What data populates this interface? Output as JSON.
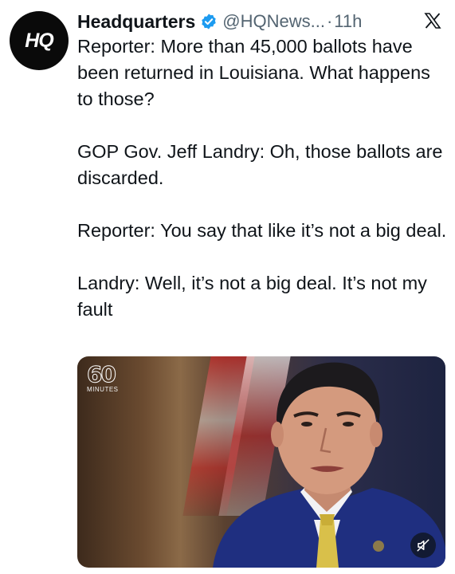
{
  "avatar": {
    "text": "HQ",
    "icon": "hq-logo-icon"
  },
  "header": {
    "display_name": "Headquarters",
    "handle": "@HQNews...",
    "separator": "·",
    "timestamp": "11h",
    "verified_icon": "verified-badge-icon",
    "platform_icon": "x-logo-icon",
    "verified_color": "#1d9bf0"
  },
  "tweet": {
    "paragraphs": [
      "Reporter: More than 45,000 ballots have been returned in Louisiana. What happens to those?",
      "GOP Gov. Jeff Landry: Oh, those ballots are discarded.",
      "Reporter: You say that like it’s not a big deal.",
      "Landry: Well, it’s not a big deal. It’s not my fault"
    ]
  },
  "media": {
    "watermark_number": "60",
    "watermark_label": "MINUTES",
    "mute_icon": "muted-speaker-icon"
  }
}
